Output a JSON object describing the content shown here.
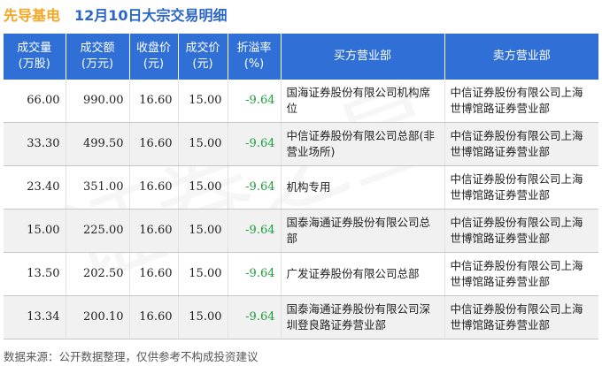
{
  "header": {
    "stock_name": "先导基电",
    "subtitle": "12月10日大宗交易明细"
  },
  "table": {
    "columns": [
      [
        "成交量",
        "(万股)"
      ],
      [
        "成交额",
        "(万元)"
      ],
      [
        "收盘价",
        "(元)"
      ],
      [
        "成交价",
        "(元)"
      ],
      [
        "折溢率",
        "(%)"
      ],
      [
        "买方营业部"
      ],
      [
        "卖方营业部"
      ]
    ],
    "rows": [
      {
        "volume": "66.00",
        "amount": "990.00",
        "close": "16.60",
        "price": "15.00",
        "rate": "-9.64",
        "buyer": "国海证券股份有限公司机构席位",
        "seller": "中信证券股份有限公司上海世博馆路证券营业部"
      },
      {
        "volume": "33.30",
        "amount": "499.50",
        "close": "16.60",
        "price": "15.00",
        "rate": "-9.64",
        "buyer": "中信证券股份有限公司总部(非营业场所)",
        "seller": "中信证券股份有限公司上海世博馆路证券营业部"
      },
      {
        "volume": "23.40",
        "amount": "351.00",
        "close": "16.60",
        "price": "15.00",
        "rate": "-9.64",
        "buyer": "机构专用",
        "seller": "中信证券股份有限公司上海世博馆路证券营业部"
      },
      {
        "volume": "15.00",
        "amount": "225.00",
        "close": "16.60",
        "price": "15.00",
        "rate": "-9.64",
        "buyer": "国泰海通证券股份有限公司总部",
        "seller": "中信证券股份有限公司上海世博馆路证券营业部"
      },
      {
        "volume": "13.50",
        "amount": "202.50",
        "close": "16.60",
        "price": "15.00",
        "rate": "-9.64",
        "buyer": "广发证券股份有限公司总部",
        "seller": "中信证券股份有限公司上海世博馆路证券营业部"
      },
      {
        "volume": "13.34",
        "amount": "200.10",
        "close": "16.60",
        "price": "15.00",
        "rate": "-9.64",
        "buyer": "国泰海通证券股份有限公司深圳登良路证券营业部",
        "seller": "中信证券股份有限公司上海世博馆路证券营业部"
      }
    ]
  },
  "footer": {
    "source": "数据来源：公开数据整理，仅供参考不构成投资建议"
  }
}
